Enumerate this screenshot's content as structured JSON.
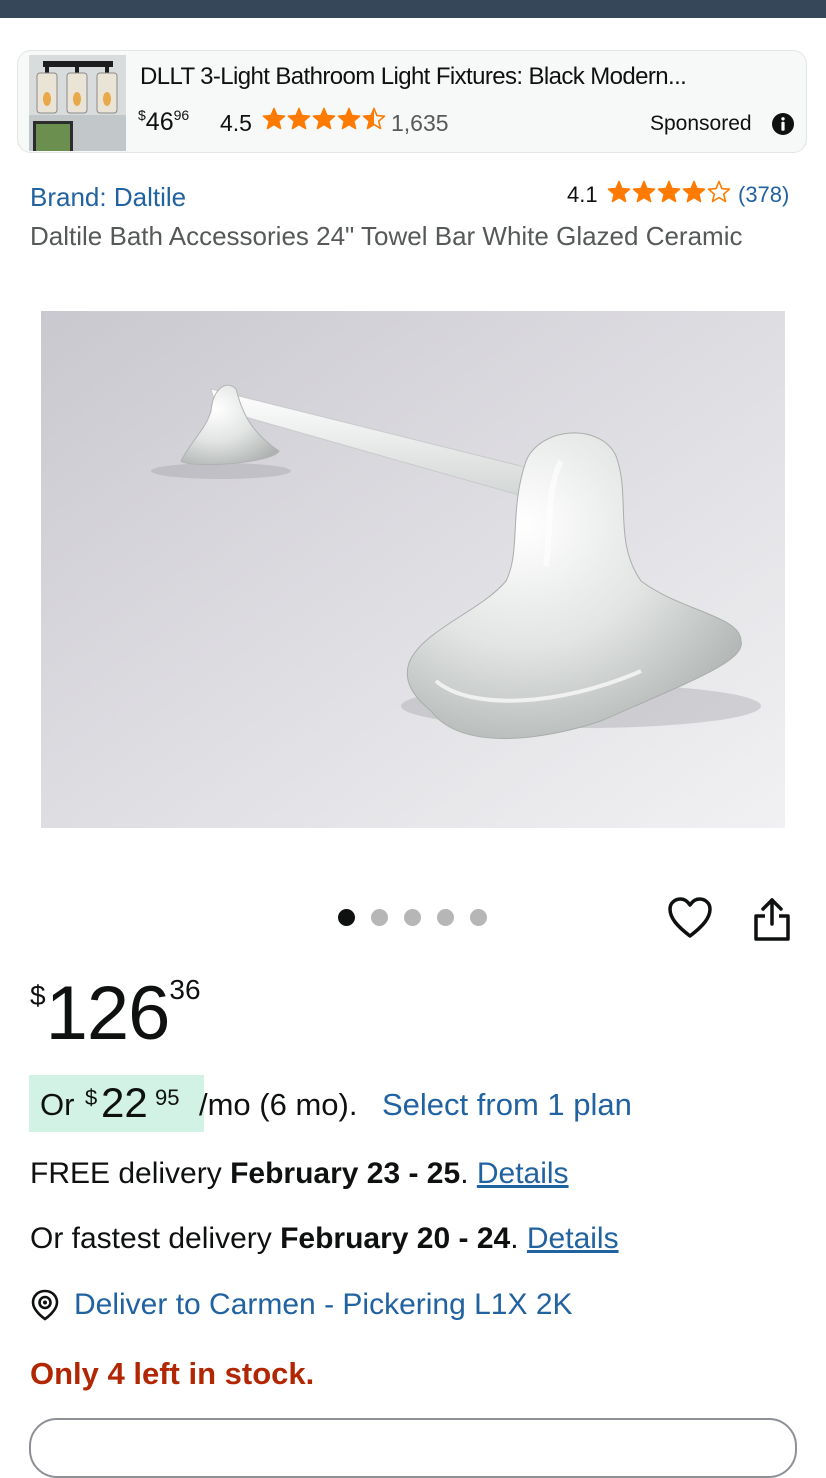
{
  "colors": {
    "top_bar": "#37475a",
    "link": "#2162a1",
    "star": "#ff7a00",
    "stock": "#b12704",
    "plan_highlight": "#d3f2e6"
  },
  "ad": {
    "title": "DLLT 3-Light Bathroom Light Fixtures: Black Modern...",
    "price_symbol": "$",
    "price_whole": "46",
    "price_fraction": "96",
    "rating": "4.5",
    "rating_value": 4.5,
    "review_count": "1,635",
    "sponsored_label": "Sponsored",
    "info_icon": "info-icon"
  },
  "product": {
    "brand_label": "Brand: Daltile",
    "rating": "4.1",
    "rating_value": 4.1,
    "review_count": "(378)",
    "title": "Daltile Bath Accessories 24\" Towel Bar White Glazed Ceramic"
  },
  "carousel": {
    "total_images": 5,
    "active_index": 0
  },
  "actions": {
    "wishlist_icon": "heart-icon",
    "share_icon": "share-icon"
  },
  "price": {
    "symbol": "$",
    "whole": "126",
    "fraction": "36"
  },
  "plan": {
    "prefix": "Or",
    "symbol": "$",
    "whole": "22",
    "fraction": "95",
    "terms": "/mo (6 mo).",
    "link": "Select from 1 plan"
  },
  "delivery": {
    "free_prefix": "FREE delivery",
    "free_dates": "February 23 - 25",
    "free_details": "Details",
    "fast_prefix": "Or fastest delivery",
    "fast_dates": "February 20 - 24",
    "fast_details": "Details",
    "deliver_to": "Deliver to Carmen - Pickering L1X 2K",
    "location_icon": "location-pin-icon"
  },
  "stock": {
    "message": "Only 4 left in stock."
  }
}
